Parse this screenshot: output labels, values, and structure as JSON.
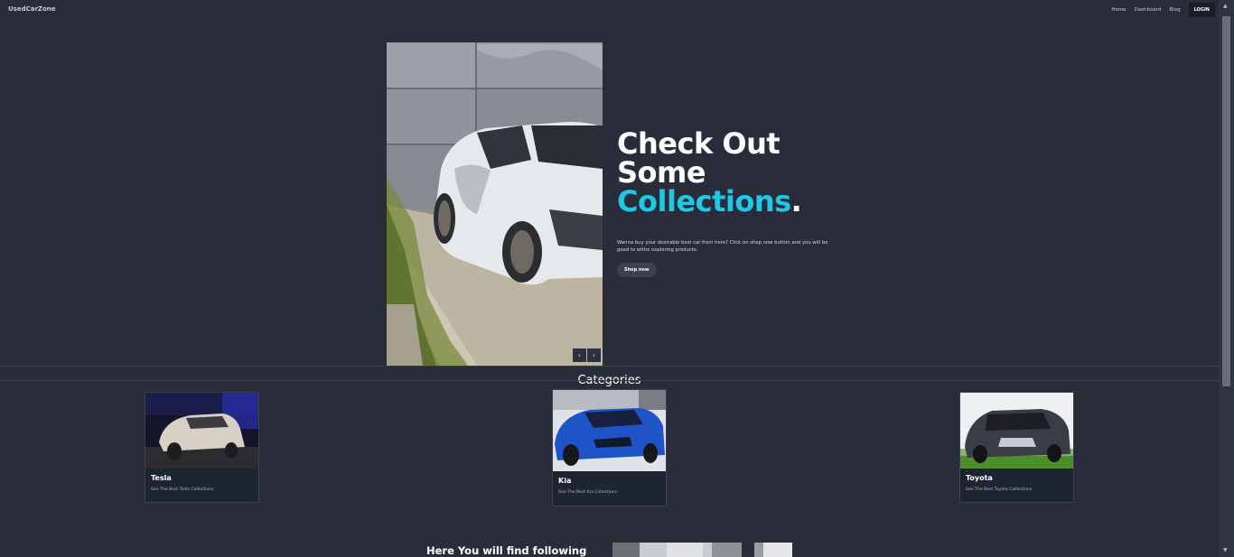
{
  "nav": {
    "brand": "UsedCarZone",
    "links": [
      "Home",
      "Dashboard",
      "Blog"
    ],
    "login_label": "LOGIN"
  },
  "hero": {
    "title_line1": "Check Out",
    "title_line2": "Some",
    "title_accent": "Collections",
    "title_period": ".",
    "description": "Wanna buy your desirable best car from here? Click on shop now button and you will be good to withe exploring products.",
    "shop_label": "Shop now",
    "prev_icon": "chevron-left-icon",
    "next_icon": "chevron-right-icon"
  },
  "categories": {
    "title": "Categories",
    "items": [
      {
        "title": "Tesla",
        "subtitle": "See The Best Tesla Collections"
      },
      {
        "title": "Kia",
        "subtitle": "See The Best Kia Collections"
      },
      {
        "title": "Toyota",
        "subtitle": "See The Best Toyota Collections"
      }
    ]
  },
  "bottom": {
    "heading": "Here You will find following"
  },
  "colors": {
    "background": "#282d39",
    "accent": "#1ec8e6"
  }
}
